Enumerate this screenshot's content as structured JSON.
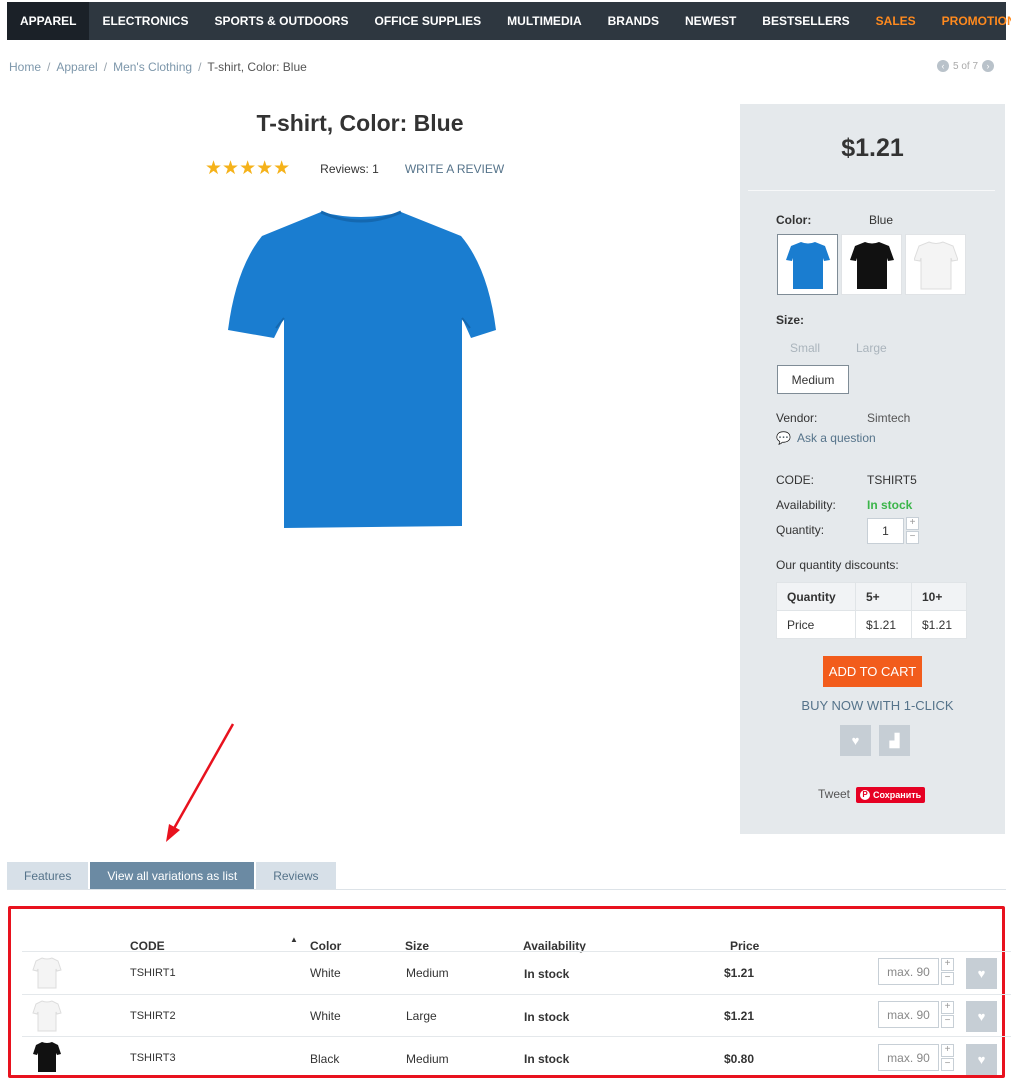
{
  "nav": {
    "items": [
      "Apparel",
      "Electronics",
      "Sports & Outdoors",
      "Office supplies",
      "Multimedia",
      "Brands",
      "Newest",
      "Bestsellers",
      "Sales",
      "Promotions"
    ],
    "accent_color": "#ff8a1e"
  },
  "breadcrumb": {
    "items": [
      "Home",
      "Apparel",
      "Men's Clothing"
    ],
    "current": "T-shirt, Color: Blue"
  },
  "pager": {
    "text": "5 of 7"
  },
  "product": {
    "title": "T-shirt, Color: Blue",
    "rating": 5,
    "stars": "★★★★★",
    "reviews": "Reviews: 1",
    "write_review": "Write a review",
    "price": "$1.21"
  },
  "options": {
    "color_label": "Color:",
    "color_value": "Blue",
    "size_label": "Size:",
    "sizes": [
      "Small",
      "Large"
    ],
    "size_selected": "Medium",
    "vendor_label": "Vendor:",
    "vendor_value": "Simtech",
    "ask_question": "Ask a question",
    "code_label": "CODE:",
    "code_value": "TSHIRT5",
    "availability_label": "Availability:",
    "availability_value": "In stock",
    "quantity_label": "Quantity:",
    "quantity_value": "1",
    "discounts_label": "Our quantity discounts:"
  },
  "discounts": {
    "headers": [
      "Quantity",
      "5+",
      "10+"
    ],
    "row_label": "Price",
    "values": [
      "$1.21",
      "$1.21"
    ]
  },
  "actions": {
    "add_to_cart": "Add to cart",
    "buy_one_click": "Buy now with 1-click",
    "tweet": "Tweet",
    "pin": "Сохранить"
  },
  "tabs": [
    "Features",
    "View all variations as list",
    "Reviews"
  ],
  "variations": {
    "headers": {
      "code": "CODE",
      "color": "Color",
      "size": "Size",
      "availability": "Availability",
      "price": "Price"
    },
    "placeholder": "max. 90",
    "rows": [
      {
        "code": "TSHIRT1",
        "color": "White",
        "size": "Medium",
        "availability": "In stock",
        "price": "$1.21"
      },
      {
        "code": "TSHIRT2",
        "color": "White",
        "size": "Large",
        "availability": "In stock",
        "price": "$1.21"
      },
      {
        "code": "TSHIRT3",
        "color": "Black",
        "size": "Medium",
        "availability": "In stock",
        "price": "$0.80"
      }
    ]
  }
}
